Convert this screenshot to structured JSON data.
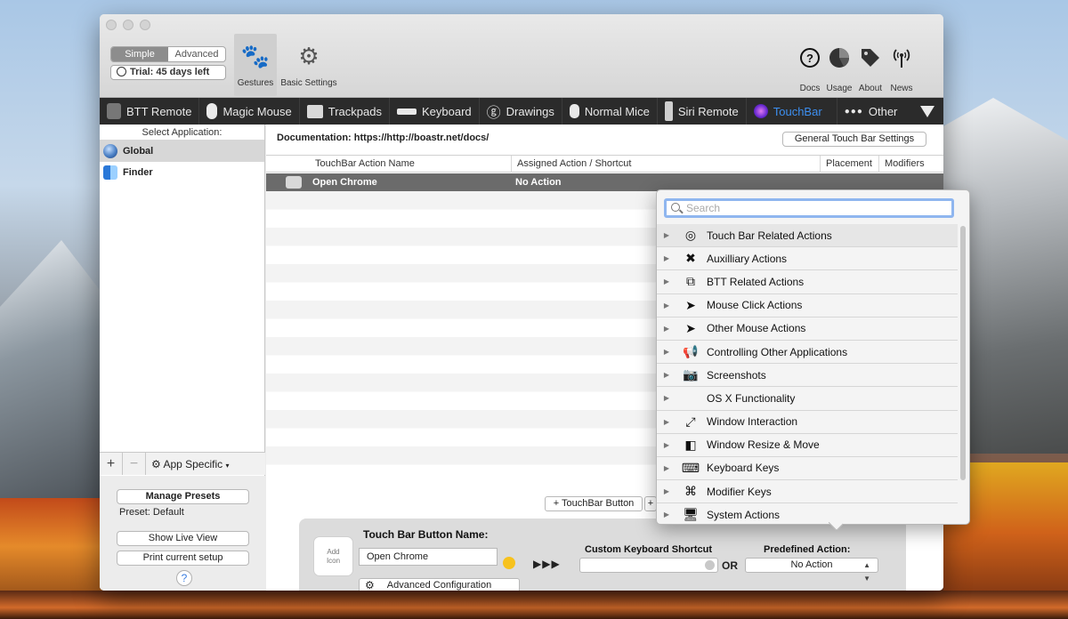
{
  "window": {
    "mode_simple": "Simple",
    "mode_advanced": "Advanced",
    "trial": "Trial: 45 days left",
    "toolbar": {
      "gestures": "Gestures",
      "basic_settings": "Basic Settings",
      "docs": "Docs",
      "usage": "Usage",
      "about": "About",
      "news": "News"
    }
  },
  "tabs": [
    {
      "label": "BTT Remote",
      "icon": "remote-icon"
    },
    {
      "label": "Magic Mouse",
      "icon": "magic-mouse-icon"
    },
    {
      "label": "Trackpads",
      "icon": "trackpad-icon"
    },
    {
      "label": "Keyboard",
      "icon": "keyboard-icon"
    },
    {
      "label": "Drawings",
      "icon": "drawing-icon"
    },
    {
      "label": "Normal Mice",
      "icon": "mouse-icon"
    },
    {
      "label": "Siri Remote",
      "icon": "siri-remote-icon"
    },
    {
      "label": "TouchBar",
      "icon": "touchbar-icon",
      "active": true
    },
    {
      "label": "Other",
      "icon": "other-dots-icon"
    }
  ],
  "sidebar": {
    "header": "Select Application:",
    "apps": [
      {
        "label": "Global",
        "selected": true
      },
      {
        "label": "Finder",
        "selected": false
      }
    ],
    "app_specific": "App Specific",
    "manage_presets": "Manage Presets",
    "preset": "Preset: Default",
    "show_live_view": "Show Live View",
    "print_setup": "Print current setup",
    "help": "?"
  },
  "main": {
    "documentation": "Documentation: https://http://boastr.net/docs/",
    "general_settings": "General Touch Bar Settings",
    "columns": {
      "name": "TouchBar Action Name",
      "assigned": "Assigned Action / Shortcut",
      "placement": "Placement",
      "modifiers": "Modifiers"
    },
    "row": {
      "name": "Open Chrome",
      "action": "No Action"
    },
    "add_button": "+ TouchBar Button",
    "add_button2": "+",
    "editor": {
      "add_icon_line1": "Add",
      "add_icon_line2": "Icon",
      "name_label": "Touch Bar Button Name:",
      "name_value": "Open Chrome",
      "arrows": "▶▶▶",
      "shortcut_label": "Custom Keyboard Shortcut",
      "or": "OR",
      "predefined_label": "Predefined Action:",
      "predefined_value": "No Action",
      "advanced": "Advanced Configuration"
    }
  },
  "popover": {
    "search_placeholder": "Search",
    "categories": [
      {
        "label": "Touch Bar Related Actions",
        "icon": "target-icon",
        "glyph": "◎"
      },
      {
        "label": "Auxilliary Actions",
        "icon": "tools-icon",
        "glyph": "✖"
      },
      {
        "label": "BTT Related Actions",
        "icon": "btt-icon",
        "glyph": "⧉"
      },
      {
        "label": "Mouse Click Actions",
        "icon": "cursor-icon",
        "glyph": "➤"
      },
      {
        "label": "Other Mouse Actions",
        "icon": "cursor-icon",
        "glyph": "➤"
      },
      {
        "label": "Controlling Other Applications",
        "icon": "megaphone-icon",
        "glyph": "📢"
      },
      {
        "label": "Screenshots",
        "icon": "camera-icon",
        "glyph": "📷"
      },
      {
        "label": "OS X Functionality",
        "icon": "apple-icon",
        "glyph": ""
      },
      {
        "label": "Window Interaction",
        "icon": "expand-icon",
        "glyph": "⤢"
      },
      {
        "label": "Window Resize & Move",
        "icon": "window-split-icon",
        "glyph": "◧"
      },
      {
        "label": "Keyboard Keys",
        "icon": "abc-key-icon",
        "glyph": "⌨"
      },
      {
        "label": "Modifier Keys",
        "icon": "command-key-icon",
        "glyph": "⌘"
      },
      {
        "label": "System Actions",
        "icon": "monitor-icon",
        "glyph": "🖥"
      }
    ]
  },
  "colors": {
    "tabbar_bg": "#2b2b2b",
    "active_tab": "#3d8ff0",
    "selected_row": "#6b6b6b",
    "search_focus": "#8fb6ef"
  }
}
